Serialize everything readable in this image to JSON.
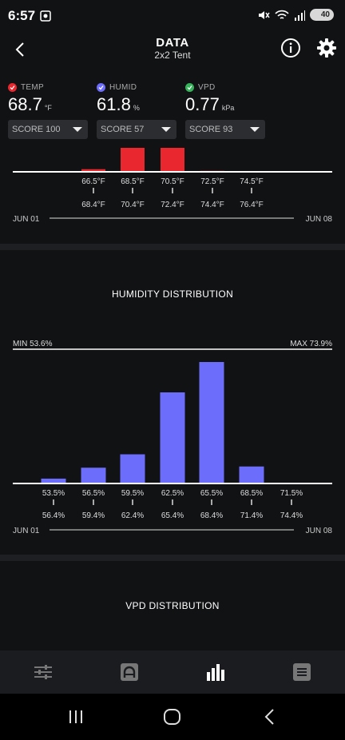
{
  "status": {
    "time": "6:57",
    "battery": "40"
  },
  "header": {
    "title": "DATA",
    "subtitle": "2x2 Tent"
  },
  "metrics": [
    {
      "label": "TEMP",
      "value": "68.7",
      "unit": "°F",
      "color": "#e8272f",
      "score": "SCORE 100"
    },
    {
      "label": "HUMID",
      "value": "61.8",
      "unit": "%",
      "color": "#6d6dfb",
      "score": "SCORE 57"
    },
    {
      "label": "VPD",
      "value": "0.77",
      "unit": "kPa",
      "color": "#35b25a",
      "score": "SCORE 93"
    }
  ],
  "temperature_chart": {
    "ranges": [
      {
        "low": "66.5°F",
        "high": "68.4°F"
      },
      {
        "low": "68.5°F",
        "high": "70.4°F"
      },
      {
        "low": "70.5°F",
        "high": "72.4°F"
      },
      {
        "low": "72.5°F",
        "high": "74.4°F"
      },
      {
        "low": "74.5°F",
        "high": "76.4°F"
      }
    ],
    "date_start": "JUN 01",
    "date_end": "JUN 08"
  },
  "humidity_chart": {
    "title": "HUMIDITY DISTRIBUTION",
    "min_label": "MIN 53.6%",
    "max_label": "MAX 73.9%",
    "date_start": "JUN 01",
    "date_end": "JUN 08"
  },
  "vpd_chart": {
    "title": "VPD DISTRIBUTION"
  },
  "chart_data": [
    {
      "type": "bar",
      "categories": [
        "66.5°F–68.4°F",
        "68.5°F–70.4°F",
        "70.5°F–72.4°F",
        "72.5°F–74.4°F",
        "74.5°F–76.4°F"
      ],
      "values": [
        11,
        100,
        100,
        4,
        0
      ],
      "color": "#e8272f",
      "note_visible": "bars cropped at top; relative heights only"
    },
    {
      "type": "bar",
      "title": "HUMIDITY DISTRIBUTION",
      "categories": [
        "53.5%–56.4%",
        "56.5%–59.4%",
        "59.5%–62.4%",
        "62.5%–65.4%",
        "65.5%–68.4%",
        "68.5%–71.4%",
        "71.5%–74.4%"
      ],
      "values": [
        4,
        13,
        24,
        75,
        100,
        14,
        0
      ],
      "color": "#6d6dfb",
      "ylim": [
        0,
        100
      ]
    }
  ],
  "bottom_nav": [
    {
      "icon": "sliders-icon",
      "active": false
    },
    {
      "icon": "controller-icon",
      "active": false
    },
    {
      "icon": "bar-chart-icon",
      "active": true
    },
    {
      "icon": "list-icon",
      "active": false
    }
  ]
}
